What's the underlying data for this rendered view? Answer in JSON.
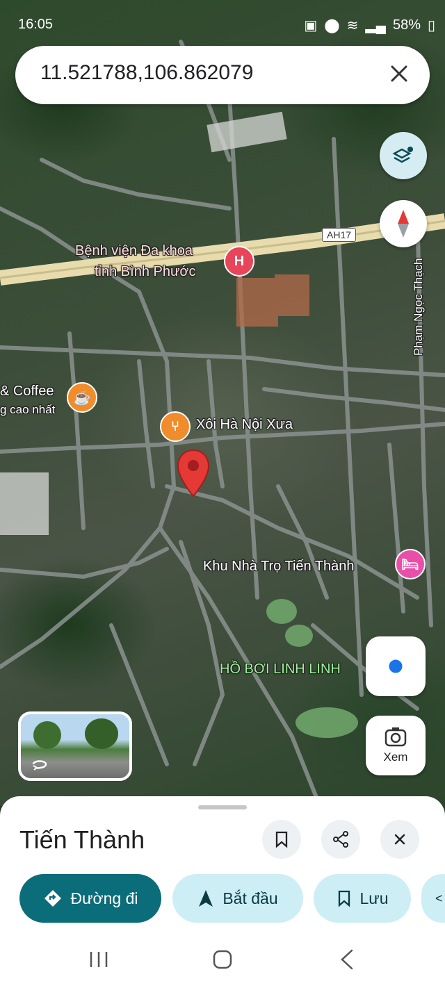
{
  "status_bar": {
    "time": "16:05",
    "battery": "58%"
  },
  "search": {
    "query": "11.521788,106.862079",
    "close_icon": "close-icon"
  },
  "map": {
    "road_label": "AH17",
    "places": {
      "hospital_line1": "Bệnh viện Đa khoa",
      "hospital_line2": "tỉnh Bình Phước",
      "cafe_line1": "& Coffee",
      "cafe_line2": "g cao nhất",
      "restaurant": "Xôi Hà Nội Xưa",
      "lodging": "Khu Nhà Trọ Tiến Thành",
      "pool": "HỒ BƠI LINH LINH",
      "street": "Phạm Ngọc Thạch"
    },
    "pin_color": "#e53935",
    "hospital_color": "#e8445a",
    "food_color": "#f08c2b",
    "lodging_color": "#e94fa8"
  },
  "controls": {
    "view_label": "Xem"
  },
  "sheet": {
    "title": "Tiến Thành",
    "actions": {
      "directions": "Đường đi",
      "start": "Bắt đầu",
      "save": "Lưu"
    },
    "accent": "#0b6c7a"
  }
}
